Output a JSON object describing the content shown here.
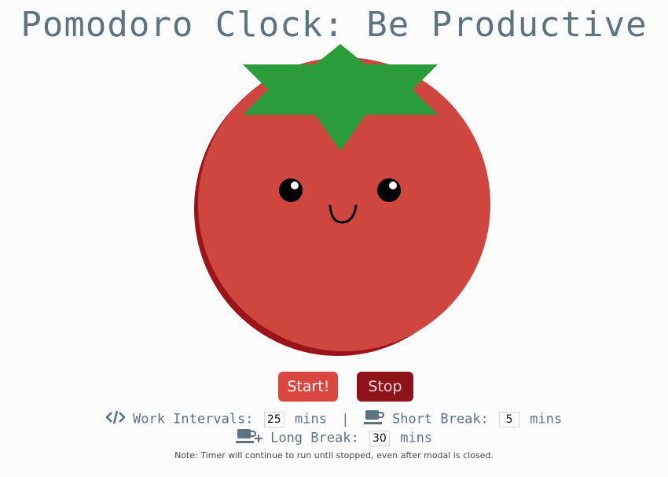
{
  "header": {
    "title": "Pomodoro Clock: Be Productive"
  },
  "tomato": {
    "body_color": "#d9473f",
    "shadow_color": "#9c1418",
    "leaf_color": "#2a9d3a"
  },
  "controls": {
    "start_label": "Start!",
    "stop_label": "Stop"
  },
  "settings": {
    "work_label": "Work Intervals:",
    "work_value": "25",
    "work_unit": "mins",
    "divider": "|",
    "short_label": "Short Break:",
    "short_value": "5",
    "short_unit": "mins",
    "long_label": "Long Break:",
    "long_value": "30",
    "long_unit": "mins"
  },
  "note": "Note: Timer will continue to run until stopped, even after modal is closed.",
  "icons": {
    "work": "code-icon",
    "short": "coffee-cup-icon",
    "long": "coffee-cup-plus-icon"
  }
}
